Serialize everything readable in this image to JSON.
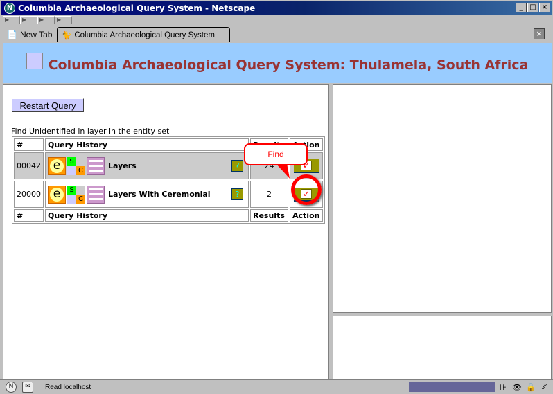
{
  "window": {
    "title": "Columbia Archaeological Query System - Netscape",
    "icon": "netscape-icon"
  },
  "tabs": [
    {
      "label": "New Tab"
    },
    {
      "label": "Columbia Archaeological Query System",
      "active": true
    }
  ],
  "banner": {
    "title": "Columbia Archaeological Query System: Thulamela, South Africa"
  },
  "left": {
    "restart_label": "Restart Query",
    "caption": "Find Unidentified in layer in the entity set",
    "headers": {
      "num": "#",
      "query": "Query History",
      "results": "Results",
      "action": "Action"
    },
    "rows": [
      {
        "num": "00042",
        "name": "Layers",
        "results": "24",
        "selected": true
      },
      {
        "num": "20000",
        "name": "Layers With Ceremonial",
        "results": "2",
        "selected": false
      }
    ],
    "icon_letters": {
      "e": "e",
      "s": "S",
      "c": "C"
    },
    "callout": "Find"
  },
  "status": {
    "text": "Read localhost"
  },
  "colors": {
    "banner": "#99ccff",
    "title": "#993333",
    "button": "#ccccff",
    "highlight": "#ff0000"
  }
}
